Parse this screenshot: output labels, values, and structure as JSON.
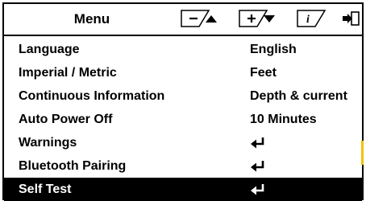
{
  "menu": {
    "title": "Menu",
    "buttons": [
      {
        "name": "minus-up-button",
        "symbol": "−",
        "arrow": "up"
      },
      {
        "name": "plus-down-button",
        "symbol": "+",
        "arrow": "down"
      },
      {
        "name": "info-button",
        "symbol": "i",
        "arrow": "exit"
      }
    ]
  },
  "items": [
    {
      "label": "Language",
      "value": "English"
    },
    {
      "label": "Imperial / Metric",
      "value": "Feet"
    },
    {
      "label": "Continuous Information",
      "value": "Depth & current"
    },
    {
      "label": "Auto Power Off",
      "value": "10 Minutes"
    },
    {
      "label": "Warnings",
      "value": "",
      "value_icon": "enter-icon"
    },
    {
      "label": "Bluetooth Pairing",
      "value": "",
      "value_icon": "enter-icon"
    },
    {
      "label": "Self Test",
      "value": "",
      "value_icon": "enter-icon",
      "selected": true
    }
  ],
  "colors": {
    "foreground": "#000000",
    "background": "#ffffff",
    "selected_background": "#000000",
    "selected_text": "#ffffff",
    "scroll_accent": "#f2c200"
  }
}
